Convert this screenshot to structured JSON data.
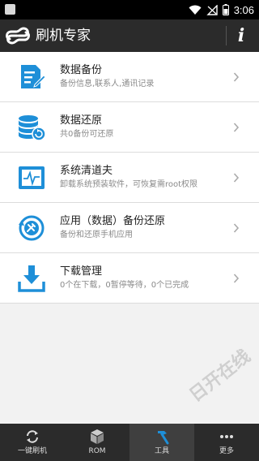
{
  "status_bar": {
    "time": "3:06",
    "icons": [
      "notification-icon",
      "wifi-icon",
      "no-sim-icon",
      "battery-icon"
    ]
  },
  "app_bar": {
    "title": "刷机专家",
    "logo": "app-logo-icon",
    "info_label": "i"
  },
  "menu": {
    "items": [
      {
        "title": "数据备份",
        "subtitle": "备份信息,联系人,通讯记录",
        "icon": "document-edit-icon"
      },
      {
        "title": "数据还原",
        "subtitle": "共0备份可还原",
        "icon": "database-restore-icon"
      },
      {
        "title": "系统清道夫",
        "subtitle": "卸载系统预装软件，可恢复需root权限",
        "icon": "system-monitor-icon"
      },
      {
        "title": "应用（数据）备份还原",
        "subtitle": "备份和还原手机应用",
        "icon": "app-backup-icon"
      },
      {
        "title": "下载管理",
        "subtitle": "0个在下载，0暂停等待，0个已完成",
        "icon": "download-icon"
      }
    ]
  },
  "bottom_nav": {
    "tabs": [
      {
        "label": "一键刷机",
        "icon": "refresh-icon",
        "active": false
      },
      {
        "label": "ROM",
        "icon": "cube-icon",
        "active": false
      },
      {
        "label": "工具",
        "icon": "hammer-icon",
        "active": true
      },
      {
        "label": "更多",
        "icon": "more-icon",
        "active": false
      }
    ]
  },
  "watermark": "日开在线",
  "colors": {
    "accent": "#1e8fd8",
    "app_bar": "#2b2b2b",
    "background": "#f2f2f2"
  }
}
